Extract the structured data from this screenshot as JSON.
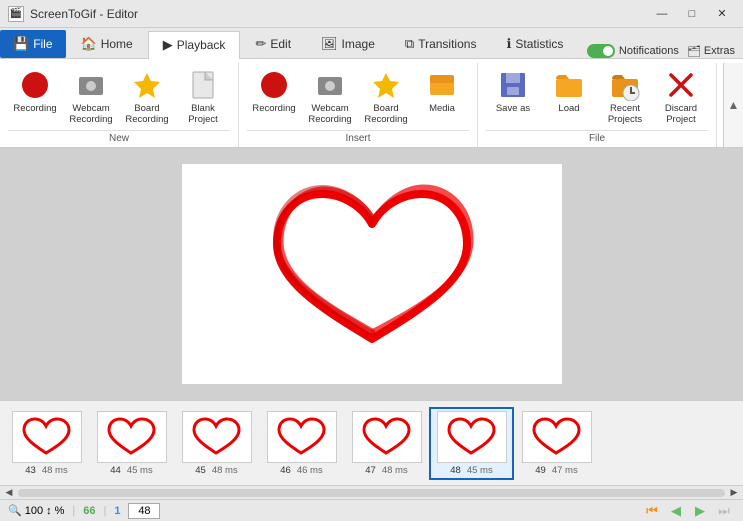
{
  "titleBar": {
    "appName": "ScreenToGif - Editor",
    "icon": "🎬"
  },
  "tabs": [
    {
      "id": "file",
      "label": "File",
      "icon": "💾",
      "active": true
    },
    {
      "id": "home",
      "label": "Home",
      "icon": "🏠",
      "active": false
    },
    {
      "id": "playback",
      "label": "Playback",
      "icon": "▶",
      "active": false
    },
    {
      "id": "edit",
      "label": "Edit",
      "icon": "✏️",
      "active": false
    },
    {
      "id": "image",
      "label": "Image",
      "icon": "🖼",
      "active": false
    },
    {
      "id": "transitions",
      "label": "Transitions",
      "icon": "⧉",
      "active": false
    },
    {
      "id": "statistics",
      "label": "Statistics",
      "icon": "ℹ",
      "active": false
    }
  ],
  "notifications": {
    "label": "Notifications",
    "enabled": true
  },
  "extras": {
    "label": "Extras",
    "icon": "🗂"
  },
  "ribbonGroups": [
    {
      "id": "new",
      "label": "New",
      "buttons": [
        {
          "id": "recording",
          "label": "Recording",
          "icon": "🔴"
        },
        {
          "id": "webcam-recording",
          "label": "Webcam Recording",
          "icon": "📷"
        },
        {
          "id": "board-recording",
          "label": "Board Recording",
          "icon": "🌟"
        },
        {
          "id": "blank-project",
          "label": "Blank Project",
          "icon": "📄"
        }
      ]
    },
    {
      "id": "insert",
      "label": "Insert",
      "buttons": [
        {
          "id": "recording-insert",
          "label": "Recording",
          "icon": "🔴"
        },
        {
          "id": "webcam-recording-insert",
          "label": "Webcam Recording",
          "icon": "📷"
        },
        {
          "id": "board-recording-insert",
          "label": "Board Recording",
          "icon": "🌟"
        },
        {
          "id": "media",
          "label": "Media",
          "icon": "📁"
        }
      ]
    },
    {
      "id": "file-group",
      "label": "File",
      "buttons": [
        {
          "id": "save-as",
          "label": "Save as",
          "icon": "💾"
        },
        {
          "id": "load",
          "label": "Load",
          "icon": "📂"
        },
        {
          "id": "recent-projects",
          "label": "Recent Projects",
          "icon": "🕐"
        },
        {
          "id": "discard-project",
          "label": "Discard Project",
          "icon": "❌"
        }
      ]
    }
  ],
  "filmstrip": {
    "frames": [
      {
        "num": 43,
        "ms": "48 ms",
        "selected": false
      },
      {
        "num": 44,
        "ms": "45 ms",
        "selected": false
      },
      {
        "num": 45,
        "ms": "48 ms",
        "selected": false
      },
      {
        "num": 46,
        "ms": "46 ms",
        "selected": false
      },
      {
        "num": 47,
        "ms": "48 ms",
        "selected": false
      },
      {
        "num": 48,
        "ms": "45 ms",
        "selected": true
      },
      {
        "num": 49,
        "ms": "47 ms",
        "selected": false
      }
    ]
  },
  "statusBar": {
    "zoom": "100",
    "zoomSymbol": "%",
    "frameCount": "66",
    "layerCount": "1",
    "cursorValue": "48"
  },
  "windowControls": {
    "minimize": "—",
    "maximize": "□",
    "close": "✕"
  }
}
